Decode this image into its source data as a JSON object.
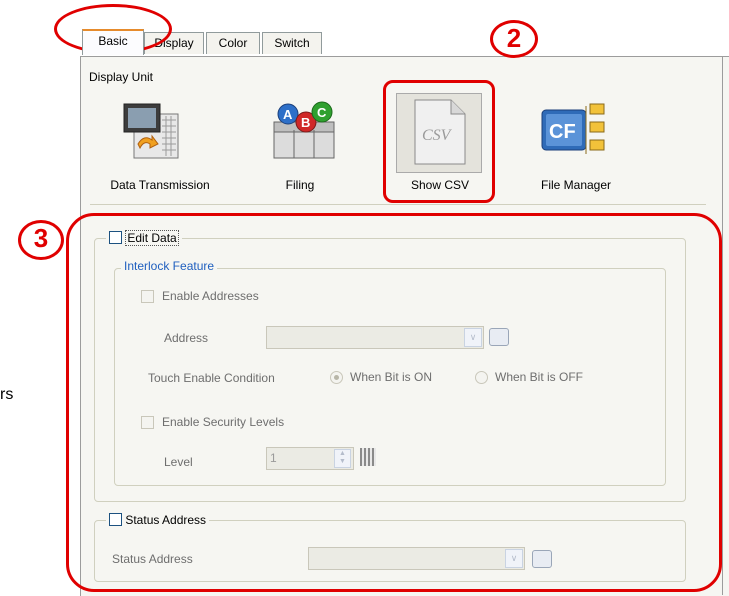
{
  "tabs": [
    "Basic",
    "Display",
    "Color",
    "Switch"
  ],
  "stray_char": "rs",
  "display_unit": {
    "label": "Display Unit",
    "buttons": [
      {
        "label": "Data Transmission",
        "icon": "data-transmission-icon"
      },
      {
        "label": "Filing",
        "icon": "filing-icon"
      },
      {
        "label": "Show CSV",
        "icon": "csv-file-icon",
        "icon_text": "CSV"
      },
      {
        "label": "File Manager",
        "icon": "cf-file-manager-icon",
        "icon_text": "CF"
      }
    ]
  },
  "edit_data": {
    "label": "Edit Data",
    "checked": false,
    "interlock": {
      "title": "Interlock Feature",
      "enable_addresses": "Enable Addresses",
      "address_label": "Address",
      "touch_condition_label": "Touch Enable Condition",
      "radio_on": "When Bit is ON",
      "radio_off": "When Bit is OFF",
      "radio_selected": "When Bit is ON",
      "enable_security": "Enable Security Levels",
      "level_label": "Level",
      "level_value": "1"
    }
  },
  "status": {
    "checkbox_label": "Status Address",
    "field_label": "Status Address",
    "checked": false
  },
  "annotations": [
    "2",
    "3"
  ],
  "colors": {
    "annotation": "#e00000",
    "group_title": "#1f5fbf",
    "tab_highlight": "#e68b2c"
  }
}
